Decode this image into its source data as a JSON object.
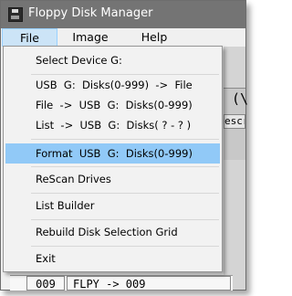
{
  "window": {
    "title": "Floppy Disk Manager"
  },
  "menubar": {
    "items": [
      {
        "label": "File",
        "active": true
      },
      {
        "label": "Image",
        "active": false
      },
      {
        "label": "Help",
        "active": false
      }
    ]
  },
  "file_menu": {
    "items": [
      {
        "label": "Select Device G:"
      },
      {
        "label": "USB  G:  Disks(0-999)  ->  File"
      },
      {
        "label": "File  ->  USB  G:  Disks(0-999)"
      },
      {
        "label": "List  ->  USB  G:  Disks( ? - ? )"
      },
      {
        "label": "Format  USB  G:  Disks(0-999)",
        "highlighted": true
      },
      {
        "label": "ReScan Drives"
      },
      {
        "label": "List Builder"
      },
      {
        "label": "Rebuild Disk Selection Grid"
      },
      {
        "label": "Exit"
      }
    ]
  },
  "background": {
    "paren_text": "(\\",
    "descr_header": "escr",
    "bottom_row": {
      "number": "009",
      "text": "FLPY -> 009"
    }
  },
  "colors": {
    "titlebar": "#747474",
    "menu_highlight": "#91c9f7",
    "menubar_active": "#cce4f7"
  }
}
